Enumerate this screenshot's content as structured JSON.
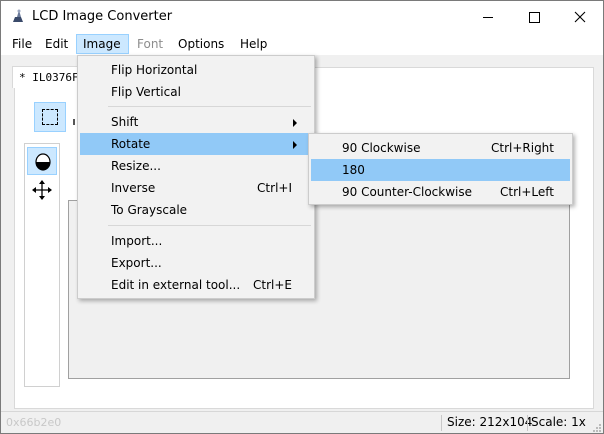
{
  "window": {
    "title": "LCD Image Converter",
    "minimize_icon": "minimize-icon",
    "maximize_icon": "maximize-icon",
    "close_icon": "close-icon"
  },
  "menubar": {
    "items": [
      {
        "label": "File",
        "state": "normal"
      },
      {
        "label": "Edit",
        "state": "normal"
      },
      {
        "label": "Image",
        "state": "active"
      },
      {
        "label": "Font",
        "state": "disabled"
      },
      {
        "label": "Options",
        "state": "normal"
      },
      {
        "label": "Help",
        "state": "normal"
      }
    ]
  },
  "document": {
    "tab_label": "* IL0376F"
  },
  "image_menu": {
    "items": [
      {
        "label": "Flip Horizontal",
        "shortcut": ""
      },
      {
        "label": "Flip Vertical",
        "shortcut": ""
      },
      {
        "label": "Shift",
        "shortcut": "",
        "submenu": true
      },
      {
        "label": "Rotate",
        "shortcut": "",
        "submenu": true,
        "highlighted": true
      },
      {
        "label": "Resize...",
        "shortcut": ""
      },
      {
        "label": "Inverse",
        "shortcut": "Ctrl+I"
      },
      {
        "label": "To Grayscale",
        "shortcut": ""
      },
      {
        "label": "Import...",
        "shortcut": ""
      },
      {
        "label": "Export...",
        "shortcut": ""
      },
      {
        "label": "Edit in external tool...",
        "shortcut": "Ctrl+E"
      }
    ]
  },
  "rotate_menu": {
    "items": [
      {
        "label": "90 Clockwise",
        "shortcut": "Ctrl+Right"
      },
      {
        "label": "180",
        "shortcut": "",
        "highlighted": true
      },
      {
        "label": "90 Counter-Clockwise",
        "shortcut": "Ctrl+Left"
      }
    ]
  },
  "status": {
    "left_text": "0x66b2e0",
    "size": "Size: 212x104",
    "scale": "Scale: 1x"
  },
  "colors": {
    "menu_highlight": "#91c9f7",
    "active_menu": "#cce8ff",
    "tool_active": "#cce8ff"
  },
  "tools": [
    "select-tool",
    "pen-tool",
    "move-tool"
  ]
}
